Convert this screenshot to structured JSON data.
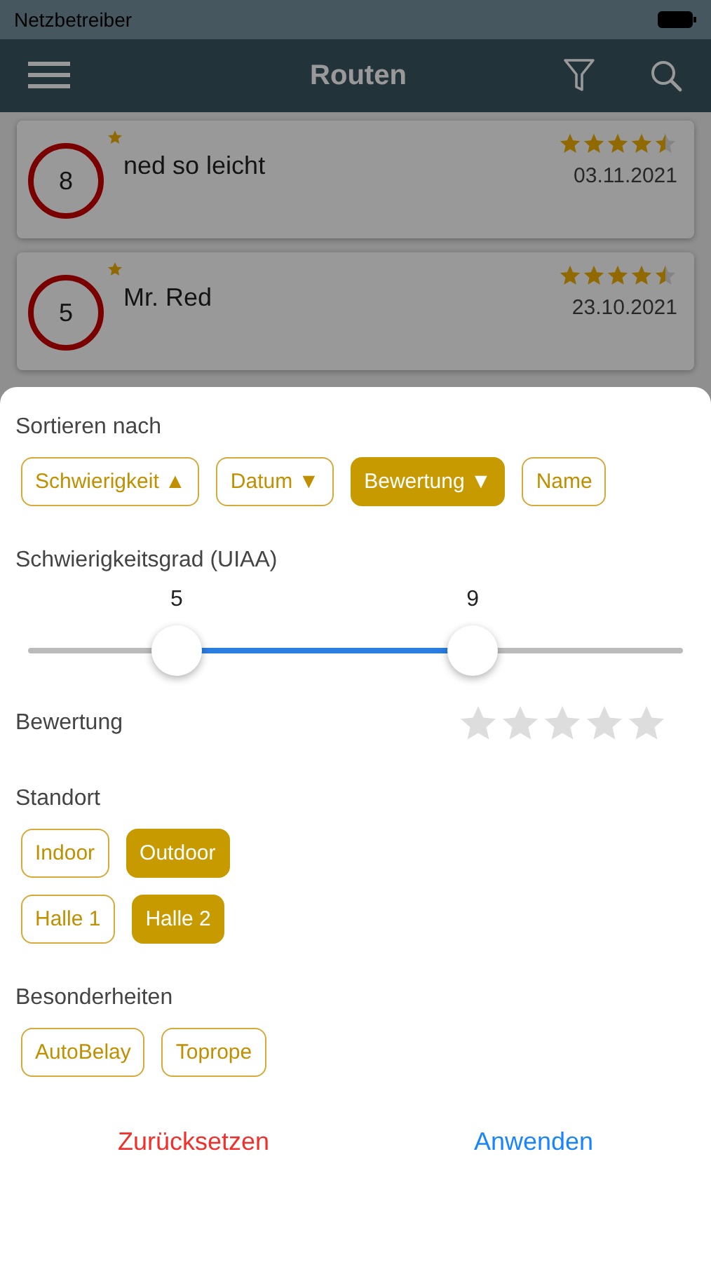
{
  "status_bar": {
    "carrier": "Netzbetreiber"
  },
  "nav_bar": {
    "title": "Routen"
  },
  "routes": [
    {
      "grade": "8",
      "favorite": true,
      "name": "ned so leicht",
      "stars": 4.5,
      "date": "03.11.2021"
    },
    {
      "grade": "5",
      "favorite": true,
      "name": "Mr. Red",
      "stars": 4.5,
      "date": "23.10.2021"
    }
  ],
  "filter_sheet": {
    "sort": {
      "title": "Sortieren nach",
      "options": [
        {
          "label": "Schwierigkeit",
          "arrow": "▲",
          "selected": false
        },
        {
          "label": "Datum",
          "arrow": "▼",
          "selected": false
        },
        {
          "label": "Bewertung",
          "arrow": "▼",
          "selected": true
        },
        {
          "label": "Name",
          "selected": false
        }
      ]
    },
    "grade": {
      "title": "Schwierigkeitsgrad (UIAA)",
      "thumbs": [
        {
          "value": "5",
          "level": 0.227
        },
        {
          "value": "9",
          "level": 0.679
        }
      ]
    },
    "rating": {
      "title": "Bewertung",
      "stars": 0
    },
    "location": {
      "title": "Standort",
      "rows": [
        [
          {
            "label": "Indoor",
            "selected": false
          },
          {
            "label": "Outdoor",
            "selected": true
          }
        ],
        [
          {
            "label": "Halle 1",
            "selected": false
          },
          {
            "label": "Halle 2",
            "selected": true
          }
        ]
      ]
    },
    "features": {
      "title": "Besonderheiten",
      "options": [
        {
          "label": "AutoBelay",
          "selected": false
        },
        {
          "label": "Toprope",
          "selected": false
        }
      ]
    },
    "buttons": [
      {
        "label": "Zurücksetzen",
        "kind": "reset"
      },
      {
        "label": "Anwenden",
        "kind": "apply"
      }
    ]
  }
}
